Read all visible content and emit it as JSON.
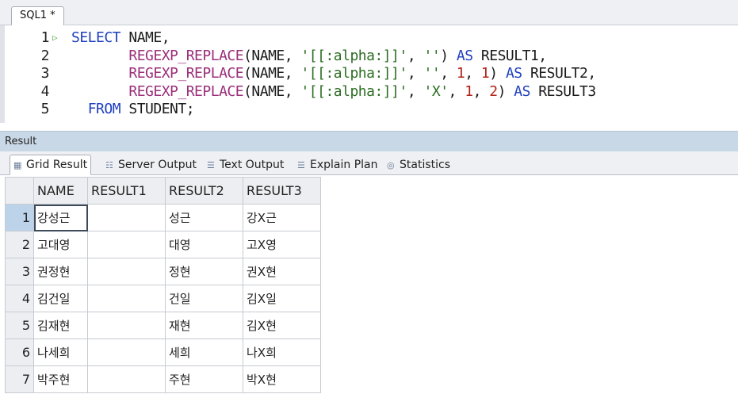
{
  "editor": {
    "tab_title": "SQL1 *",
    "lines": [
      {
        "no": "1",
        "segs": [
          [
            "kw",
            "SELECT "
          ],
          [
            "plain",
            "NAME,"
          ]
        ]
      },
      {
        "no": "2",
        "segs": [
          [
            "plain",
            "       "
          ],
          [
            "fn",
            "REGEXP_REPLACE"
          ],
          [
            "plain",
            "(NAME, "
          ],
          [
            "str",
            "'[[:alpha:]]'"
          ],
          [
            "plain",
            ", "
          ],
          [
            "str",
            "''"
          ],
          [
            "plain",
            ") "
          ],
          [
            "kw",
            "AS "
          ],
          [
            "plain",
            "RESULT1,"
          ]
        ]
      },
      {
        "no": "3",
        "segs": [
          [
            "plain",
            "       "
          ],
          [
            "fn",
            "REGEXP_REPLACE"
          ],
          [
            "plain",
            "(NAME, "
          ],
          [
            "str",
            "'[[:alpha:]]'"
          ],
          [
            "plain",
            ", "
          ],
          [
            "str",
            "''"
          ],
          [
            "plain",
            ", "
          ],
          [
            "num",
            "1"
          ],
          [
            "plain",
            ", "
          ],
          [
            "num",
            "1"
          ],
          [
            "plain",
            ") "
          ],
          [
            "kw",
            "AS "
          ],
          [
            "plain",
            "RESULT2,"
          ]
        ]
      },
      {
        "no": "4",
        "segs": [
          [
            "plain",
            "       "
          ],
          [
            "fn",
            "REGEXP_REPLACE"
          ],
          [
            "plain",
            "(NAME, "
          ],
          [
            "str",
            "'[[:alpha:]]'"
          ],
          [
            "plain",
            ", "
          ],
          [
            "str",
            "'X'"
          ],
          [
            "plain",
            ", "
          ],
          [
            "num",
            "1"
          ],
          [
            "plain",
            ", "
          ],
          [
            "num",
            "2"
          ],
          [
            "plain",
            ") "
          ],
          [
            "kw",
            "AS "
          ],
          [
            "plain",
            "RESULT3"
          ]
        ]
      },
      {
        "no": "5",
        "segs": [
          [
            "plain",
            "  "
          ],
          [
            "kw",
            "FROM "
          ],
          [
            "plain",
            "STUDENT;"
          ]
        ]
      }
    ]
  },
  "result": {
    "header": "Result",
    "tabs": [
      {
        "label": "Grid Result",
        "icon": "grid-icon"
      },
      {
        "label": "Server Output",
        "icon": "server-output-icon"
      },
      {
        "label": "Text Output",
        "icon": "text-output-icon"
      },
      {
        "label": "Explain Plan",
        "icon": "explain-plan-icon"
      },
      {
        "label": "Statistics",
        "icon": "statistics-icon"
      }
    ],
    "columns": [
      "NAME",
      "RESULT1",
      "RESULT2",
      "RESULT3"
    ],
    "rows": [
      {
        "n": "1",
        "cells": [
          "강성근",
          "",
          "성근",
          "강X근"
        ]
      },
      {
        "n": "2",
        "cells": [
          "고대영",
          "",
          "대영",
          "고X영"
        ]
      },
      {
        "n": "3",
        "cells": [
          "권정현",
          "",
          "정현",
          "권X현"
        ]
      },
      {
        "n": "4",
        "cells": [
          "김건일",
          "",
          "건일",
          "김X일"
        ]
      },
      {
        "n": "5",
        "cells": [
          "김재현",
          "",
          "재현",
          "김X현"
        ]
      },
      {
        "n": "6",
        "cells": [
          "나세희",
          "",
          "세희",
          "나X희"
        ]
      },
      {
        "n": "7",
        "cells": [
          "박주현",
          "",
          "주현",
          "박X현"
        ]
      }
    ]
  }
}
